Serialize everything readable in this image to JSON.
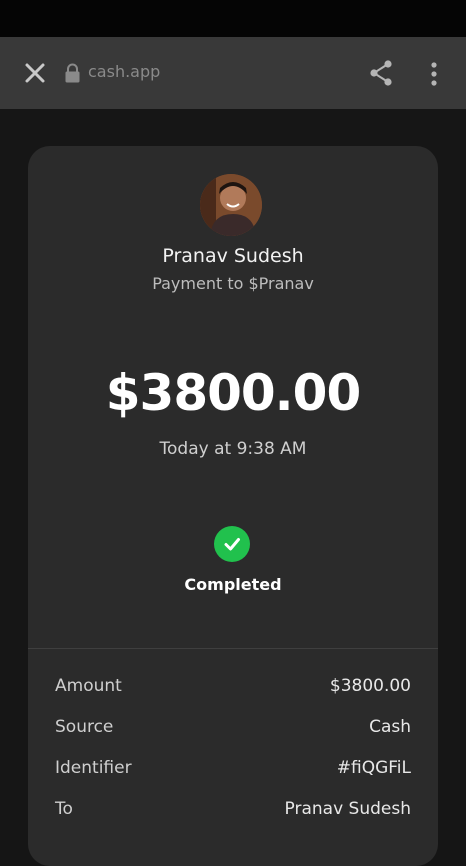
{
  "browser": {
    "url": "cash.app"
  },
  "payment": {
    "recipient_name": "Pranav Sudesh",
    "subtitle": "Payment to $Pranav",
    "amount": "$3800.00",
    "timestamp": "Today at 9:38 AM",
    "status": "Completed",
    "status_color": "#21c14d"
  },
  "details": [
    {
      "label": "Amount",
      "value": "$3800.00"
    },
    {
      "label": "Source",
      "value": "Cash"
    },
    {
      "label": "Identifier",
      "value": "#fiQGFiL"
    },
    {
      "label": "To",
      "value": "Pranav Sudesh"
    }
  ],
  "icons": {
    "close": "close-icon",
    "lock": "lock-icon",
    "share": "share-icon",
    "menu": "more-vertical-icon",
    "status": "checkmark-icon"
  }
}
